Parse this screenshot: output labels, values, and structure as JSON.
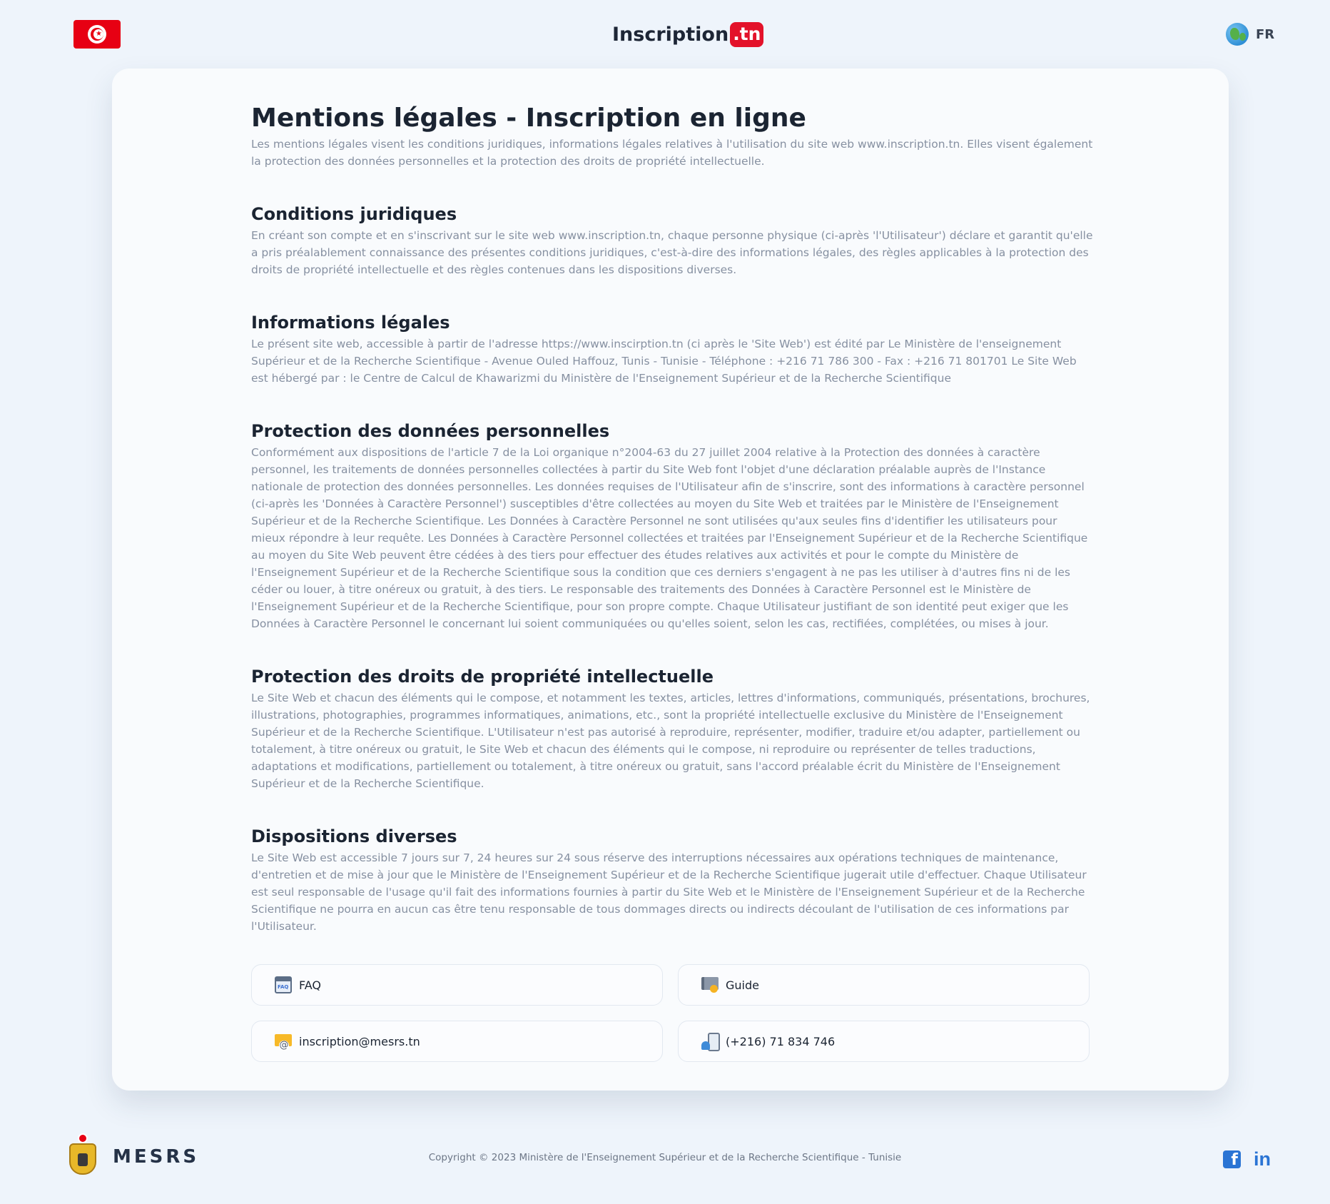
{
  "header": {
    "logo_main": "Inscription",
    "logo_badge": ".tn",
    "language": "FR"
  },
  "content": {
    "title": "Mentions légales - Inscription en ligne",
    "lead": "Les mentions légales visent les conditions juridiques, informations légales relatives à l'utilisation du site web www.inscription.tn. Elles visent également la protection des données personnelles et la protection des droits de propriété intellectuelle.",
    "sections": [
      {
        "title": "Conditions juridiques",
        "body": "En créant son compte et en s'inscrivant sur le site web www.inscription.tn, chaque personne physique (ci-après 'l'Utilisateur') déclare et garantit qu'elle a pris préalablement connaissance des présentes conditions juridiques, c'est-à-dire des informations légales, des règles applicables à la protection des droits de propriété intellectuelle et des règles contenues dans les dispositions diverses."
      },
      {
        "title": "Informations légales",
        "body": "Le présent site web, accessible à partir de l'adresse https://www.inscirption.tn (ci après le 'Site Web') est édité par Le Ministère de l'enseignement Supérieur et de la Recherche Scientifique - Avenue Ouled Haffouz, Tunis - Tunisie - Téléphone : +216 71 786 300 - Fax : +216 71 801701 Le Site Web est hébergé par : le Centre de Calcul de Khawarizmi du Ministère de l'Enseignement Supérieur et de la Recherche Scientifique"
      },
      {
        "title": "Protection des données personnelles",
        "body": "Conformément aux dispositions de l'article 7 de la Loi organique n°2004-63 du 27 juillet 2004 relative à la Protection des données à caractère personnel, les traitements de données personnelles collectées à partir du Site Web font l'objet d'une déclaration préalable auprès de l'Instance nationale de protection des données personnelles. Les données requises de l'Utilisateur afin de s'inscrire, sont des informations à caractère personnel (ci-après les 'Données à Caractère Personnel') susceptibles d'être collectées au moyen du Site Web et traitées par le Ministère de l'Enseignement Supérieur et de la Recherche Scientifique. Les Données à Caractère Personnel ne sont utilisées qu'aux seules fins d'identifier les utilisateurs pour mieux répondre à leur requête. Les Données à Caractère Personnel collectées et traitées par l'Enseignement Supérieur et de la Recherche Scientifique au moyen du Site Web peuvent être cédées à des tiers pour effectuer des études relatives aux activités et pour le compte du Ministère de l'Enseignement Supérieur et de la Recherche Scientifique sous la condition que ces derniers s'engagent à ne pas les utiliser à d'autres fins ni de les céder ou louer, à titre onéreux ou gratuit, à des tiers. Le responsable des traitements des Données à Caractère Personnel est le Ministère de l'Enseignement Supérieur et de la Recherche Scientifique, pour son propre compte. Chaque Utilisateur justifiant de son identité peut exiger que les Données à Caractère Personnel le concernant lui soient communiquées ou qu'elles soient, selon les cas, rectifiées, complétées, ou mises à jour."
      },
      {
        "title": "Protection des droits de propriété intellectuelle",
        "body": "Le Site Web et chacun des éléments qui le compose, et notamment les textes, articles, lettres d'informations, communiqués, présentations, brochures, illustrations, photographies, programmes informatiques, animations, etc., sont la propriété intellectuelle exclusive du Ministère de l'Enseignement Supérieur et de la Recherche Scientifique. L'Utilisateur n'est pas autorisé à reproduire, représenter, modifier, traduire et/ou adapter, partiellement ou totalement, à titre onéreux ou gratuit, le Site Web et chacun des éléments qui le compose, ni reproduire ou représenter de telles traductions, adaptations et modifications, partiellement ou totalement, à titre onéreux ou gratuit, sans l'accord préalable écrit du Ministère de l'Enseignement Supérieur et de la Recherche Scientifique."
      },
      {
        "title": "Dispositions diverses",
        "body": "Le Site Web est accessible 7 jours sur 7, 24 heures sur 24 sous réserve des interruptions nécessaires aux opérations techniques de maintenance, d'entretien et de mise à jour que le Ministère de l'Enseignement Supérieur et de la Recherche Scientifique jugerait utile d'effectuer. Chaque Utilisateur est seul responsable de l'usage qu'il fait des informations fournies à partir du Site Web et le Ministère de l'Enseignement Supérieur et de la Recherche Scientifique ne pourra en aucun cas être tenu responsable de tous dommages directs ou indirects découlant de l'utilisation de ces informations par l'Utilisateur."
      }
    ]
  },
  "contacts": {
    "faq": "FAQ",
    "guide": "Guide",
    "email": "inscription@mesrs.tn",
    "phone": "(+216) 71 834 746"
  },
  "footer": {
    "org": "MESRS",
    "copyright": "Copyright © 2023 Ministère de l'Enseignement Supérieur et de la Recherche Scientifique - Tunisie",
    "linkedin_glyph": "in",
    "facebook_glyph": "f"
  },
  "colors": {
    "accent_red": "#e3122a",
    "background": "#eef4fb",
    "text_muted": "#8690a1",
    "social_blue": "#2a74d4"
  },
  "icons": [
    "tunisia-flag-icon",
    "globe-icon",
    "faq-icon",
    "guide-icon",
    "mail-icon",
    "phone-icon",
    "emblem-icon",
    "facebook-icon",
    "linkedin-icon"
  ]
}
